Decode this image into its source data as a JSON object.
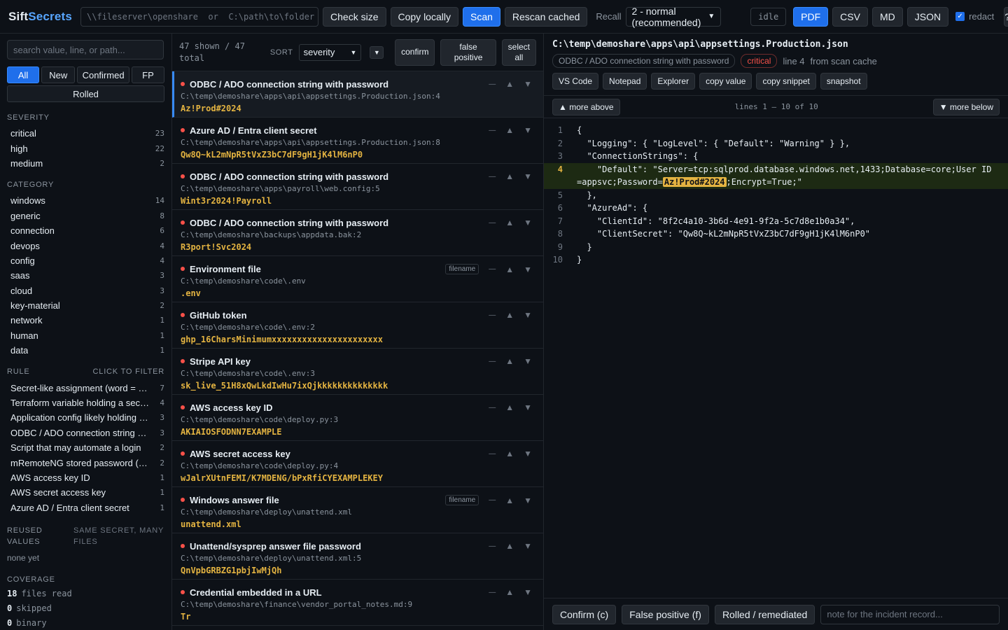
{
  "app": {
    "name_a": "Sift",
    "name_b": "Secrets"
  },
  "toolbar": {
    "path_placeholder": "\\\\fileserver\\openshare  or  C:\\path\\to\\folder",
    "check_size": "Check size",
    "copy_locally": "Copy locally",
    "scan": "Scan",
    "rescan_cached": "Rescan cached",
    "recall_label": "Recall",
    "recall_value": "2 - normal (recommended)",
    "status": "idle",
    "export_pdf": "PDF",
    "export_csv": "CSV",
    "export_md": "MD",
    "export_json": "JSON",
    "redact_label": "redact",
    "redact_checked": true,
    "help": "?"
  },
  "sidebar": {
    "search_placeholder": "search value, line, or path...",
    "filters": [
      "All",
      "New",
      "Confirmed",
      "FP"
    ],
    "filter_rolled": "Rolled",
    "active_filter": "All",
    "severity_title": "SEVERITY",
    "severity": [
      {
        "label": "critical",
        "count": "23"
      },
      {
        "label": "high",
        "count": "22"
      },
      {
        "label": "medium",
        "count": "2"
      }
    ],
    "category_title": "CATEGORY",
    "category": [
      {
        "label": "windows",
        "count": "14"
      },
      {
        "label": "generic",
        "count": "8"
      },
      {
        "label": "connection",
        "count": "6"
      },
      {
        "label": "devops",
        "count": "4"
      },
      {
        "label": "config",
        "count": "4"
      },
      {
        "label": "saas",
        "count": "3"
      },
      {
        "label": "cloud",
        "count": "3"
      },
      {
        "label": "key-material",
        "count": "2"
      },
      {
        "label": "network",
        "count": "1"
      },
      {
        "label": "human",
        "count": "1"
      },
      {
        "label": "data",
        "count": "1"
      }
    ],
    "rule_title": "RULE",
    "rule_hint": "CLICK TO FILTER",
    "rules": [
      {
        "label": "Secret-like assignment (word = value)",
        "count": "7"
      },
      {
        "label": "Terraform variable holding a secret",
        "count": "4"
      },
      {
        "label": "Application config likely holding a c...",
        "count": "3"
      },
      {
        "label": "ODBC / ADO connection string with ...",
        "count": "3"
      },
      {
        "label": "Script that may automate a login",
        "count": "2"
      },
      {
        "label": "mRemoteNG stored password (defa...",
        "count": "2"
      },
      {
        "label": "AWS access key ID",
        "count": "1"
      },
      {
        "label": "AWS secret access key",
        "count": "1"
      },
      {
        "label": "Azure AD / Entra client secret",
        "count": "1"
      }
    ],
    "reused_title_a": "REUSED",
    "reused_title_b": "VALUES",
    "reused_hint_a": "SAME SECRET, MANY",
    "reused_hint_b": "FILES",
    "reused_empty": "none yet",
    "coverage_title": "COVERAGE",
    "coverage": [
      {
        "num": "18",
        "label": "files read"
      },
      {
        "num": "0",
        "label": "skipped"
      },
      {
        "num": "0",
        "label": "binary"
      }
    ]
  },
  "list": {
    "shown_a": "47 shown / 47",
    "shown_b": "total",
    "sort_label": "SORT",
    "sort_value": "severity",
    "sort_dir": "▼",
    "confirm": "confirm",
    "false_positive": "false positive",
    "select_all_a": "select",
    "select_all_b": "all",
    "items": [
      {
        "title": "ODBC / ADO connection string with password",
        "path": "C:\\temp\\demoshare\\apps\\api\\appsettings.Production.json:4",
        "value": "Az!Prod#2024",
        "tag": ""
      },
      {
        "title": "Azure AD / Entra client secret",
        "path": "C:\\temp\\demoshare\\apps\\api\\appsettings.Production.json:8",
        "value": "Qw8Q~kL2mNpR5tVxZ3bC7dF9gH1jK4lM6nP0",
        "tag": ""
      },
      {
        "title": "ODBC / ADO connection string with password",
        "path": "C:\\temp\\demoshare\\apps\\payroll\\web.config:5",
        "value": "Wint3r2024!Payroll",
        "tag": ""
      },
      {
        "title": "ODBC / ADO connection string with password",
        "path": "C:\\temp\\demoshare\\backups\\appdata.bak:2",
        "value": "R3port!Svc2024",
        "tag": ""
      },
      {
        "title": "Environment file",
        "path": "C:\\temp\\demoshare\\code\\.env",
        "value": ".env",
        "tag": "filename"
      },
      {
        "title": "GitHub token",
        "path": "C:\\temp\\demoshare\\code\\.env:2",
        "value": "ghp_16CharsMinimumxxxxxxxxxxxxxxxxxxxxxx",
        "tag": ""
      },
      {
        "title": "Stripe API key",
        "path": "C:\\temp\\demoshare\\code\\.env:3",
        "value": "sk_live_51H8xQwLkdIwHu7ixQjkkkkkkkkkkkkkk",
        "tag": ""
      },
      {
        "title": "AWS access key ID",
        "path": "C:\\temp\\demoshare\\code\\deploy.py:3",
        "value": "AKIAIOSFODNN7EXAMPLE",
        "tag": ""
      },
      {
        "title": "AWS secret access key",
        "path": "C:\\temp\\demoshare\\code\\deploy.py:4",
        "value": "wJalrXUtnFEMI/K7MDENG/bPxRfiCYEXAMPLEKEY",
        "tag": ""
      },
      {
        "title": "Windows answer file",
        "path": "C:\\temp\\demoshare\\deploy\\unattend.xml",
        "value": "unattend.xml",
        "tag": "filename"
      },
      {
        "title": "Unattend/sysprep answer file password",
        "path": "C:\\temp\\demoshare\\deploy\\unattend.xml:5",
        "value": "QnVpbGRBZG1pbjIwMjQh",
        "tag": ""
      },
      {
        "title": "Credential embedded in a URL",
        "path": "C:\\temp\\demoshare\\finance\\vendor_portal_notes.md:9",
        "value": "Tr",
        "tag": ""
      }
    ]
  },
  "detail": {
    "path": "C:\\temp\\demoshare\\apps\\api\\appsettings.Production.json",
    "rule": "ODBC / ADO connection string with password",
    "severity": "critical",
    "line": "line 4",
    "source": "from scan cache",
    "actions": [
      "VS Code",
      "Notepad",
      "Explorer",
      "copy value",
      "copy snippet",
      "snapshot"
    ],
    "more_above": "▲ more above",
    "lines_info": "lines 1 – 10 of 10",
    "more_below": "▼ more below",
    "code": [
      {
        "n": "1",
        "t": "{"
      },
      {
        "n": "2",
        "t": "  \"Logging\": { \"LogLevel\": { \"Default\": \"Warning\" } },"
      },
      {
        "n": "3",
        "t": "  \"ConnectionStrings\": {"
      },
      {
        "n": "4",
        "pre": "    \"Default\": \"Server=tcp:sqlprod.database.windows.net,1433;Database=core;User ID=appsvc;Password=",
        "secret": "Az!Prod#2024",
        "post": ";Encrypt=True;\""
      },
      {
        "n": "5",
        "t": "  },"
      },
      {
        "n": "6",
        "t": "  \"AzureAd\": {"
      },
      {
        "n": "7",
        "t": "    \"ClientId\": \"8f2c4a10-3b6d-4e91-9f2a-5c7d8e1b0a34\","
      },
      {
        "n": "8",
        "t": "    \"ClientSecret\": \"Qw8Q~kL2mNpR5tVxZ3bC7dF9gH1jK4lM6nP0\""
      },
      {
        "n": "9",
        "t": "  }"
      },
      {
        "n": "10",
        "t": "}"
      }
    ],
    "confirm_btn": "Confirm (c)",
    "fp_btn": "False positive (f)",
    "rolled_btn": "Rolled / remediated",
    "note_placeholder": "note for the incident record..."
  }
}
